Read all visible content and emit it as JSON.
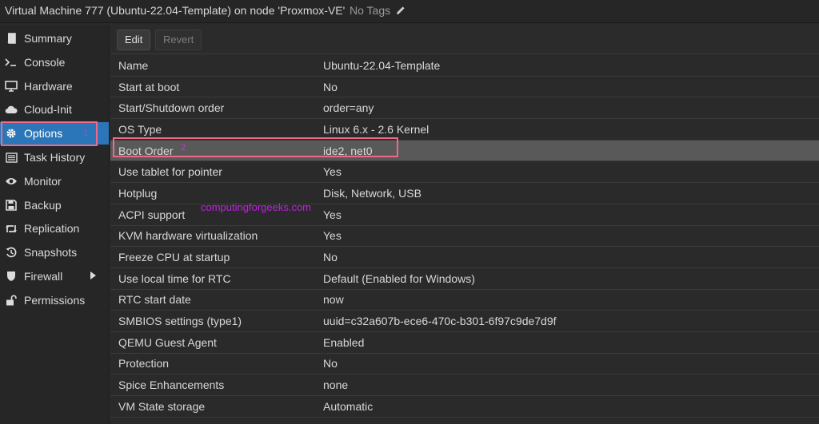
{
  "window": {
    "title": "Virtual Machine 777 (Ubuntu-22.04-Template) on node 'Proxmox-VE'",
    "tags_label": "No Tags",
    "tags_icon": "pencil-icon"
  },
  "sidebar": {
    "items": [
      {
        "label": "Summary",
        "icon": "book-icon"
      },
      {
        "label": "Console",
        "icon": "terminal-icon"
      },
      {
        "label": "Hardware",
        "icon": "monitor-icon"
      },
      {
        "label": "Cloud-Init",
        "icon": "cloud-icon"
      },
      {
        "label": "Options",
        "icon": "gear-icon",
        "active": true
      },
      {
        "label": "Task History",
        "icon": "list-icon"
      },
      {
        "label": "Monitor",
        "icon": "eye-icon"
      },
      {
        "label": "Backup",
        "icon": "floppy-icon"
      },
      {
        "label": "Replication",
        "icon": "retweet-icon"
      },
      {
        "label": "Snapshots",
        "icon": "history-icon"
      },
      {
        "label": "Firewall",
        "icon": "shield-icon",
        "has_submenu": true
      },
      {
        "label": "Permissions",
        "icon": "unlock-icon"
      }
    ]
  },
  "toolbar": {
    "edit_label": "Edit",
    "revert_label": "Revert"
  },
  "options": {
    "rows": [
      {
        "key": "Name",
        "value": "Ubuntu-22.04-Template"
      },
      {
        "key": "Start at boot",
        "value": "No"
      },
      {
        "key": "Start/Shutdown order",
        "value": "order=any"
      },
      {
        "key": "OS Type",
        "value": "Linux 6.x - 2.6 Kernel"
      },
      {
        "key": "Boot Order",
        "value": "ide2, net0",
        "selected": true
      },
      {
        "key": "Use tablet for pointer",
        "value": "Yes"
      },
      {
        "key": "Hotplug",
        "value": "Disk, Network, USB"
      },
      {
        "key": "ACPI support",
        "value": "Yes"
      },
      {
        "key": "KVM hardware virtualization",
        "value": "Yes"
      },
      {
        "key": "Freeze CPU at startup",
        "value": "No"
      },
      {
        "key": "Use local time for RTC",
        "value": "Default (Enabled for Windows)"
      },
      {
        "key": "RTC start date",
        "value": "now"
      },
      {
        "key": "SMBIOS settings (type1)",
        "value": "uuid=c32a607b-ece6-470c-b301-6f97c9de7d9f"
      },
      {
        "key": "QEMU Guest Agent",
        "value": "Enabled"
      },
      {
        "key": "Protection",
        "value": "No"
      },
      {
        "key": "Spice Enhancements",
        "value": "none"
      },
      {
        "key": "VM State storage",
        "value": "Automatic"
      }
    ]
  },
  "annotations": {
    "marker_1": "1",
    "marker_2": "2",
    "watermark": "computingforgeeks.com",
    "highlight_color": "#f06a87"
  },
  "colors": {
    "accent": "#2a76b8",
    "selected_row": "#595959",
    "background": "#2a2a2a"
  }
}
